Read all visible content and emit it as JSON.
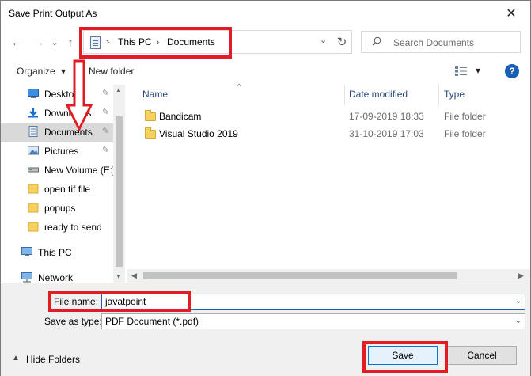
{
  "window": {
    "title": "Save Print Output As",
    "close_glyph": "✕"
  },
  "address": {
    "crumbs": [
      "This PC",
      "Documents"
    ],
    "separator": "›",
    "chevron": "⌄",
    "refresh_glyph": "↻"
  },
  "search": {
    "placeholder": "Search Documents"
  },
  "nav_buttons": {
    "back": "←",
    "forward": "→",
    "recent": "⌄",
    "up": "↑"
  },
  "toolbar": {
    "organize": "Organize",
    "organize_caret": "▾",
    "new_folder": "New folder",
    "view_caret": "▾",
    "help": "?"
  },
  "nav_pane": {
    "items": [
      {
        "label": "Desktop",
        "icon": "desktop-icon",
        "pinned": true
      },
      {
        "label": "Downloads",
        "icon": "downloads-icon",
        "pinned": true
      },
      {
        "label": "Documents",
        "icon": "documents-icon",
        "pinned": true,
        "selected": true
      },
      {
        "label": "Pictures",
        "icon": "pictures-icon",
        "pinned": true
      },
      {
        "label": "New Volume (E:)",
        "icon": "drive-icon",
        "pinned": false
      },
      {
        "label": "open tif file",
        "icon": "folder-icon",
        "pinned": false
      },
      {
        "label": "popups",
        "icon": "folder-icon",
        "pinned": false
      },
      {
        "label": "ready to send",
        "icon": "folder-icon",
        "pinned": false
      }
    ],
    "roots": [
      {
        "label": "This PC",
        "icon": "computer-icon"
      },
      {
        "label": "Network",
        "icon": "network-icon"
      }
    ],
    "pin_glyph": "📌"
  },
  "files": {
    "columns": {
      "name": "Name",
      "date": "Date modified",
      "type": "Type"
    },
    "sort_glyph": "^",
    "rows": [
      {
        "name": "Bandicam",
        "date": "17-09-2019 18:33",
        "type": "File folder"
      },
      {
        "name": "Visual Studio 2019",
        "date": "31-10-2019 17:03",
        "type": "File folder"
      }
    ]
  },
  "form": {
    "file_name_label": "File name:",
    "file_name_value": "javatpoint",
    "save_type_label": "Save as type:",
    "save_type_value": "PDF Document (*.pdf)",
    "dropdown_glyph": "⌄"
  },
  "footer": {
    "hide_folders": "Hide Folders",
    "hide_glyph": "▲",
    "save": "Save",
    "cancel": "Cancel"
  },
  "colors": {
    "annotation_red": "#e11c24",
    "accent_blue": "#1a5fb4"
  }
}
